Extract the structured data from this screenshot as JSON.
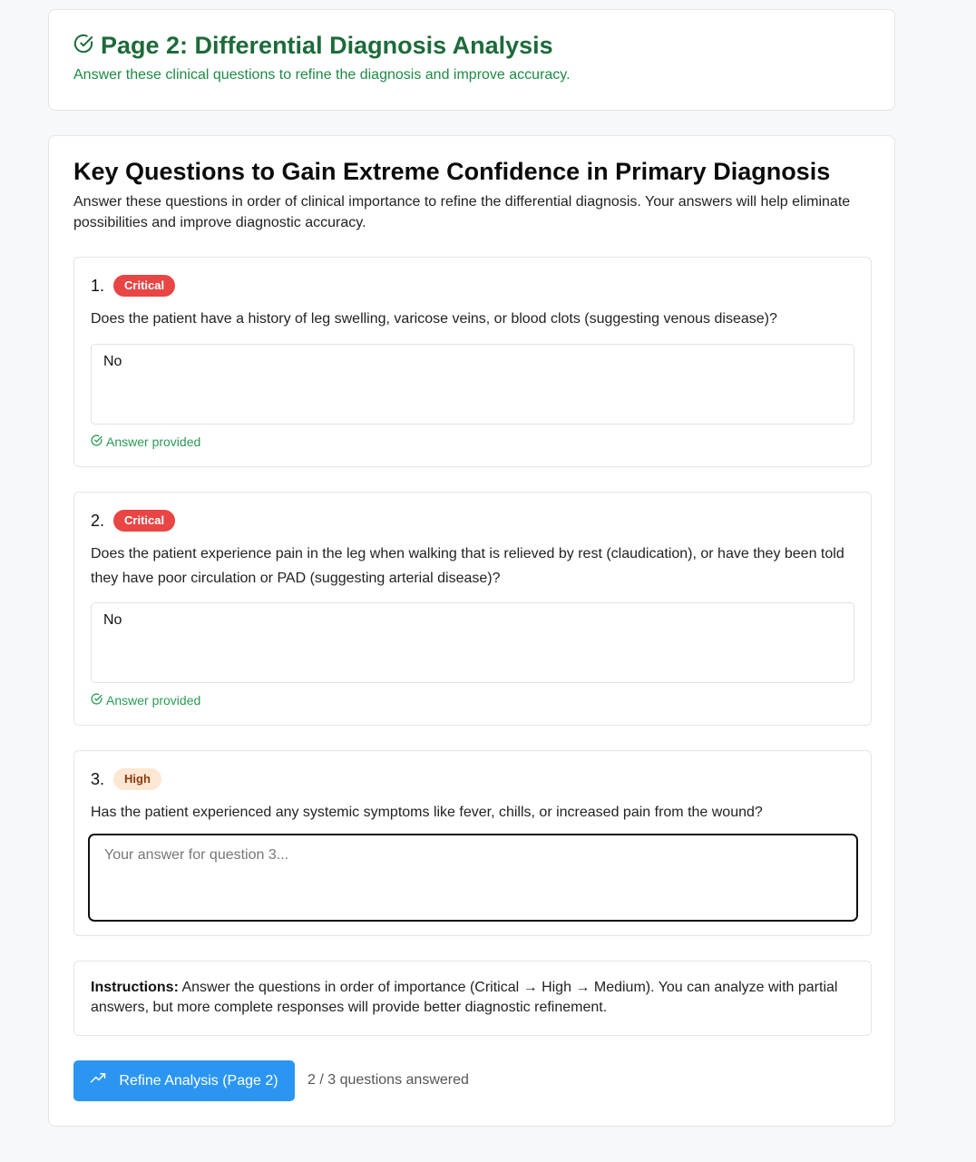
{
  "header": {
    "title": "Page 2: Differential Diagnosis Analysis",
    "subtitle": "Answer these clinical questions to refine the diagnosis and improve accuracy.",
    "icon": "check-circle-icon"
  },
  "main": {
    "title": "Key Questions to Gain Extreme Confidence in Primary Diagnosis",
    "description": "Answer these questions in order of clinical importance to refine the differential diagnosis. Your answers will help eliminate possibilities and improve diagnostic accuracy."
  },
  "questions": [
    {
      "number": "1.",
      "priority": "Critical",
      "text": "Does the patient have a history of leg swelling, varicose veins, or blood clots (suggesting venous disease)?",
      "answer": "No",
      "status": "Answer provided"
    },
    {
      "number": "2.",
      "priority": "Critical",
      "text": "Does the patient experience pain in the leg when walking that is relieved by rest (claudication), or have they been told they have poor circulation or PAD (suggesting arterial disease)?",
      "answer": "No",
      "status": "Answer provided"
    },
    {
      "number": "3.",
      "priority": "High",
      "text": "Has the patient experienced any systemic symptoms like fever, chills, or increased pain from the wound?",
      "answer": "",
      "placeholder": "Your answer for question 3..."
    }
  ],
  "instructions": {
    "label": "Instructions:",
    "text": " Answer the questions in order of importance (Critical → High → Medium). You can analyze with partial answers, but more complete responses will provide better diagnostic refinement."
  },
  "actions": {
    "refine_label": "Refine Analysis (Page 2)",
    "refine_icon": "trending-up-icon",
    "progress_text": "2 / 3 questions answered"
  },
  "colors": {
    "header_green": "#1d6b3a",
    "critical": "#e94545",
    "high_bg": "#fde7d2",
    "button_blue": "#2b96f1",
    "success_green": "#2a9a53"
  }
}
